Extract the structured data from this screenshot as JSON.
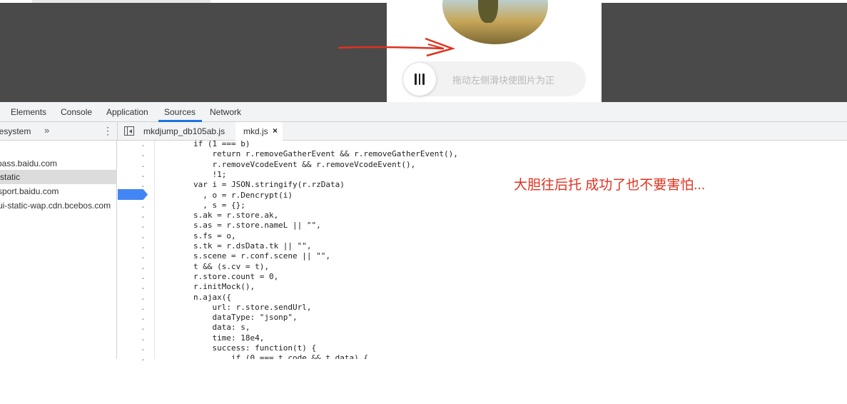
{
  "captcha": {
    "hint": "拖动左侧滑块使图片为正"
  },
  "colors": {
    "accent": "#1a73e8",
    "annotation": "#e0321f",
    "overlay": "#4a4a4a"
  },
  "devtools": {
    "tabs": [
      {
        "label": "Elements"
      },
      {
        "label": "Console"
      },
      {
        "label": "Application"
      },
      {
        "label": "Sources",
        "active": true
      },
      {
        "label": "Network"
      }
    ],
    "navigator": {
      "header": "lesystem",
      "more": "»",
      "items": [
        "pass.baidu.com",
        "static",
        "sport.baidu.com",
        "ui-static-wap.cdn.bcebos.com"
      ],
      "selected_index": 1
    },
    "files": [
      {
        "label": "mkdjump_db105ab.js"
      },
      {
        "label": "mkd.js",
        "active": true,
        "close": "×"
      }
    ],
    "code_lines": [
      "        if (1 === b)",
      "            return r.removeGatherEvent && r.removeGatherEvent(),",
      "            r.removeVcodeEvent && r.removeVcodeEvent(),",
      "            !1;",
      "        var i = JSON.stringify(r.rzData)",
      "          , o = r.Dencrypt(i)",
      "          , s = {};",
      "        s.ak = r.store.ak,",
      "        s.as = r.store.nameL || \"\",",
      "        s.fs = o,",
      "        s.tk = r.dsData.tk || \"\",",
      "        s.scene = r.conf.scene || \"\",",
      "        t && (s.cv = t),",
      "        r.store.count = 0,",
      "        r.initMock(),",
      "        n.ajax({",
      "            url: r.store.sendUrl,",
      "            dataType: \"jsonp\",",
      "            data: s,",
      "            time: 18e4,",
      "            success: function(t) {",
      "                if (0 === t.code && t.data) {"
    ],
    "gutter_mark": "-"
  },
  "annotation": "大胆往后托 成功了也不要害怕..."
}
